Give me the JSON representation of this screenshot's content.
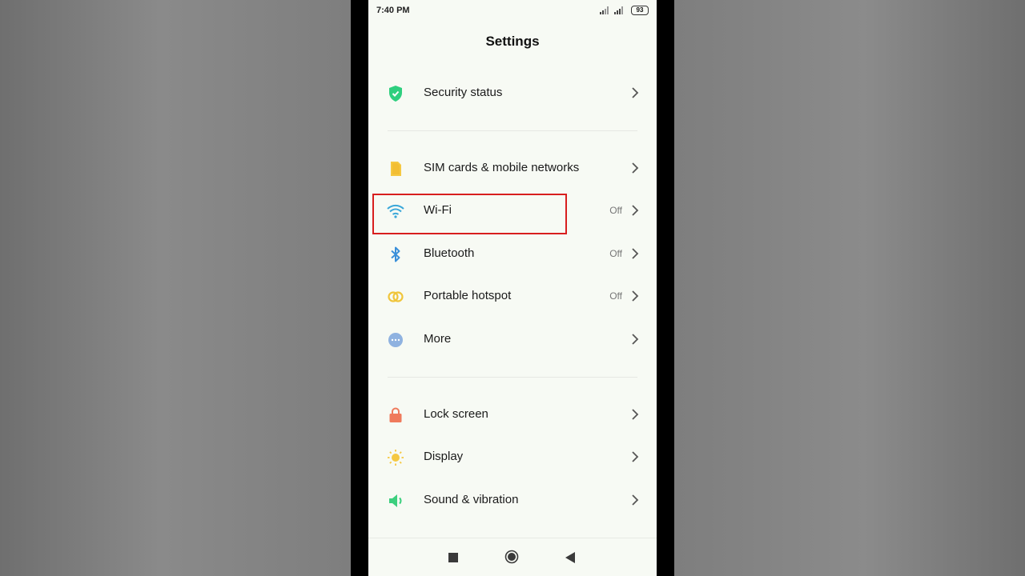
{
  "status_bar": {
    "time": "7:40 PM",
    "battery": "93"
  },
  "header": {
    "title": "Settings"
  },
  "items": [
    {
      "label": "Security status",
      "status": "",
      "icon": "shield-check-icon"
    },
    {
      "label": "SIM cards & mobile networks",
      "status": "",
      "icon": "sim-card-icon"
    },
    {
      "label": "Wi-Fi",
      "status": "Off",
      "icon": "wifi-icon"
    },
    {
      "label": "Bluetooth",
      "status": "Off",
      "icon": "bluetooth-icon"
    },
    {
      "label": "Portable hotspot",
      "status": "Off",
      "icon": "hotspot-icon"
    },
    {
      "label": "More",
      "status": "",
      "icon": "more-icon"
    },
    {
      "label": "Lock screen",
      "status": "",
      "icon": "lock-icon"
    },
    {
      "label": "Display",
      "status": "",
      "icon": "sun-icon"
    },
    {
      "label": "Sound & vibration",
      "status": "",
      "icon": "speaker-icon"
    }
  ],
  "colors": {
    "shield": "#2ecf7e",
    "sim": "#f5c842",
    "wifi": "#3aa7d9",
    "bluetooth": "#3a8fd9",
    "hotspot": "#f0c53a",
    "more": "#8fb2e0",
    "lock": "#ef7a5c",
    "sun": "#f5c842",
    "speaker": "#3ccf7e",
    "highlight": "#d81e1e"
  },
  "nav": {
    "buttons": [
      "recents-icon",
      "home-icon",
      "back-icon"
    ]
  }
}
